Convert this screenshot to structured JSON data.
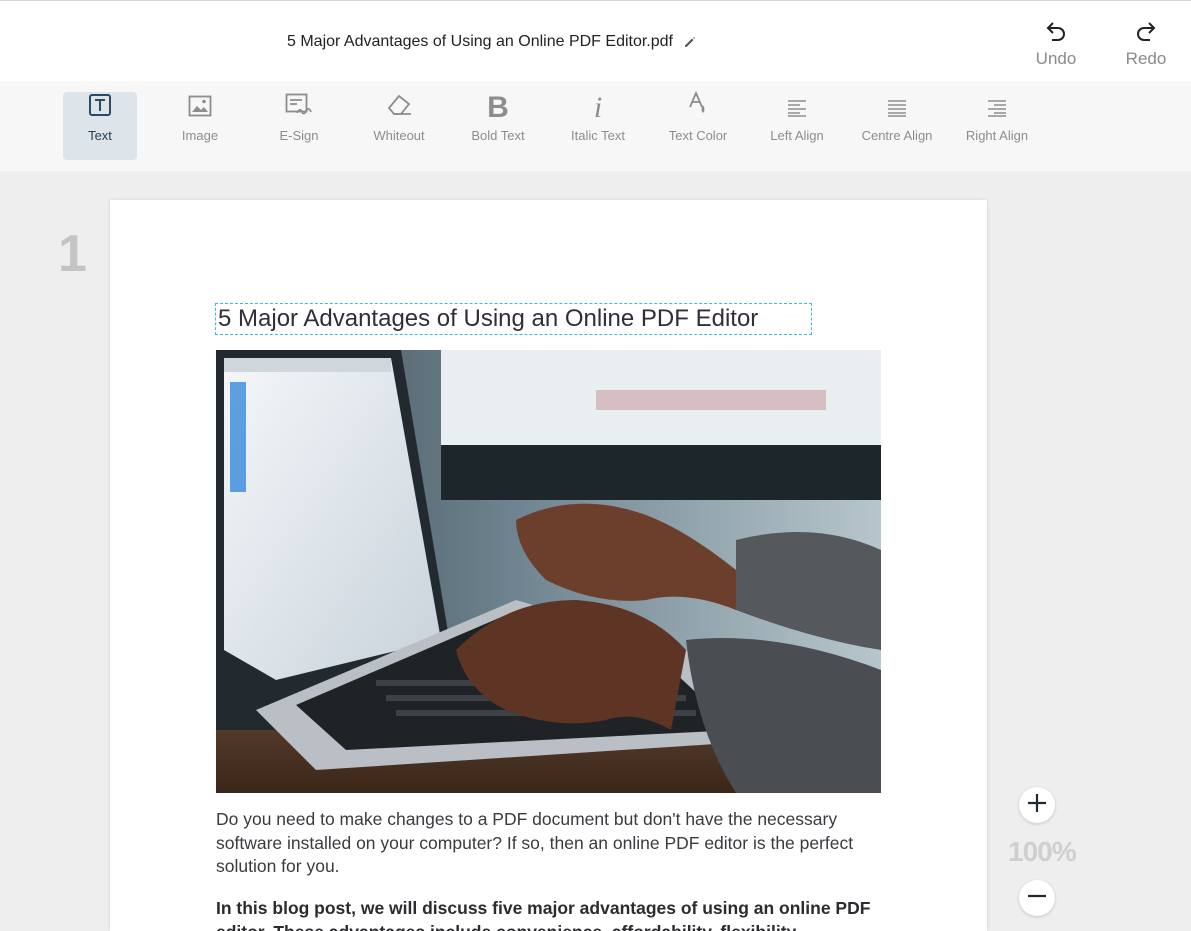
{
  "header": {
    "filename": "5 Major Advantages of Using an Online PDF Editor.pdf",
    "rename_icon": "pencil-icon",
    "undo_label": "Undo",
    "redo_label": "Redo"
  },
  "toolbar": {
    "active": "Text",
    "tools": [
      {
        "label": "Text",
        "icon": "text-box-icon"
      },
      {
        "label": "Image",
        "icon": "image-icon"
      },
      {
        "label": "E-Sign",
        "icon": "signature-icon"
      },
      {
        "label": "Whiteout",
        "icon": "eraser-icon"
      },
      {
        "label": "Bold Text",
        "icon": "bold-icon"
      },
      {
        "label": "Italic Text",
        "icon": "italic-icon"
      },
      {
        "label": "Text Color",
        "icon": "text-color-icon"
      },
      {
        "label": "Left Align",
        "icon": "align-left-icon"
      },
      {
        "label": "Centre Align",
        "icon": "align-center-icon"
      },
      {
        "label": "Right Align",
        "icon": "align-right-icon"
      }
    ]
  },
  "document": {
    "page_number": "1",
    "title": "5 Major Advantages of Using an Online PDF Editor",
    "paragraph1": "Do you need to make changes to a PDF document but don't have the necessary software installed on your computer? If so, then an online PDF editor is the perfect solution for you.",
    "paragraph2": "In this blog post, we will discuss five major advantages of using an online PDF editor. These advantages include convenience, affordability, flexibility"
  },
  "zoom": {
    "level": "100%"
  },
  "colors": {
    "accent": "#3fb8d9",
    "active_tool_bg": "#dde5ea",
    "icon_gray": "#8d8d8d"
  }
}
